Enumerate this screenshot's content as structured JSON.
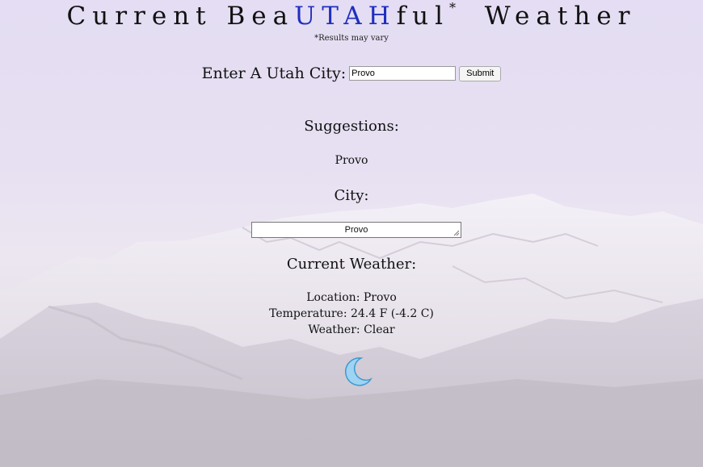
{
  "header": {
    "title_prefix": "Current Bea",
    "title_highlight": "UTAH",
    "title_suffix": "ful",
    "title_asterisk": "*",
    "title_end": "Weather",
    "subnote": "*Results may vary"
  },
  "form": {
    "label": "Enter A Utah City:",
    "input_value": "Provo",
    "submit_label": "Submit"
  },
  "suggestions": {
    "heading": "Suggestions:",
    "items": [
      "Provo"
    ]
  },
  "city": {
    "heading": "City:",
    "value": "Provo"
  },
  "weather": {
    "heading": "Current Weather:",
    "location": "Location: Provo",
    "temperature": "Temperature: 24.4 F (-4.2 C)",
    "condition": "Weather: Clear",
    "icon": "crescent-moon-icon"
  },
  "colors": {
    "highlight": "#1f2fbf",
    "moon_fill": "#9fd3f2",
    "moon_stroke": "#3d9ad1"
  }
}
